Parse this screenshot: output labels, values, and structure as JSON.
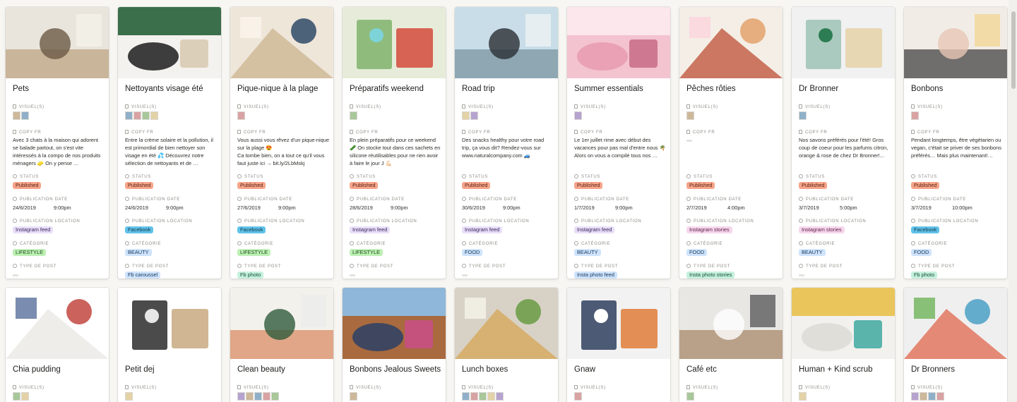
{
  "labels": {
    "visuels": "VISUEL(S)",
    "copy": "COPY FR",
    "status": "STATUS",
    "date": "PUBLICATION DATE",
    "location": "PUBLICATION LOCATION",
    "categorie": "CATÉGORIE",
    "type": "TYPE DE POST"
  },
  "row1": [
    {
      "title": "Pets",
      "copy": "Avec 3 chats à la maison qui adorent se balade partout, on s'est vite intéressés à la compo de nos produits ménagers 🧽 On y pense …",
      "status": "Published",
      "date": "24/6/2019",
      "time": "9:00pm",
      "location": "Instagram feed",
      "categorie": "LIFESTYLE",
      "type": ""
    },
    {
      "title": "Nettoyants visage été",
      "copy": "Entre la crème solaire et la pollution, il est primordial de bien nettoyer son visage en été 💦 Découvrez notre sélection de nettoyants et de …",
      "status": "Published",
      "date": "24/6/2019",
      "time": "9:00pm",
      "location": "Facebook",
      "categorie": "BEAUTY",
      "type": "Fb caroussel"
    },
    {
      "title": "Pique-nique à la plage",
      "copy": "Vous aussi vous rêvez d'un pique-nique sur la plage 😍\nCa tombe bien, on a tout ce qu'il vous faut juste ici → bit.ly/2LbMskj",
      "status": "Published",
      "date": "27/6/2019",
      "time": "9:00pm",
      "location": "Facebook",
      "categorie": "LIFESTYLE",
      "type": "Fb photo"
    },
    {
      "title": "Préparatifs weekend",
      "copy": "En plein préparatifs pour ce weekend 🥒 On stocke tout dans ces sachets en silicone réutilisables pour ne rien avoir à faire le jour J 💪🏻",
      "status": "Published",
      "date": "28/6/2019",
      "time": "9:00pm",
      "location": "Instagram feed",
      "categorie": "LIFESTYLE",
      "type": ""
    },
    {
      "title": "Road trip",
      "copy": "Des snacks healthy pour votre road trip, ça vous dit?  Rendez-vous sur www.naturalcompany.com 🚙",
      "status": "Published",
      "date": "30/6/2019",
      "time": "9:00pm",
      "location": "Instagram feed",
      "categorie": "FOOD",
      "type": ""
    },
    {
      "title": "Summer essentials",
      "copy": "Le 1er juillet rime avec début des vacances pour pas mal d'entre nous 🌴\nAlors on vous a compilé tous nos …",
      "status": "Published",
      "date": "1/7/2019",
      "time": "9:00pm",
      "location": "Instagram feed",
      "categorie": "BEAUTY",
      "type": "Insta photo feed"
    },
    {
      "title": "Pêches rôties",
      "copy": "",
      "status": "Published",
      "date": "2/7/2019",
      "time": "4:00pm",
      "location": "Instagram stories",
      "categorie": "FOOD",
      "type": "Insta photo stories"
    },
    {
      "title": "Dr Bronner",
      "copy": "Nos savons préférés pour l'été! Gros coup de coeur pour les parfums citron, orange & rose de chez Dr Bronner!...",
      "status": "Published",
      "date": "3/7/2019",
      "time": "5:00pm",
      "location": "Instagram stories",
      "categorie": "BEAUTY",
      "type": ""
    },
    {
      "title": "Bonbons",
      "copy": "Pendant longtemps, être végétarien ou vegan, c'était se priver de ses bonbons préférés… Mais plus maintenant!…",
      "status": "Published",
      "date": "3/7/2019",
      "time": "10:00pm",
      "location": "Facebook",
      "categorie": "FOOD",
      "type": "Fb photo"
    }
  ],
  "row2": [
    {
      "title": "Chia pudding"
    },
    {
      "title": "Petit dej"
    },
    {
      "title": "Clean beauty"
    },
    {
      "title": "Bonbons Jealous Sweets"
    },
    {
      "title": "Lunch boxes"
    },
    {
      "title": "Gnaw"
    },
    {
      "title": "Café etc"
    },
    {
      "title": "Human + Kind scrub"
    },
    {
      "title": "Dr Bronners"
    }
  ],
  "colors": {
    "published": "#f6a58a",
    "instagram_feed": "#e8def7",
    "facebook": "#62c3ea",
    "instagram_stories": "#f6d7ec",
    "lifestyle": "#bdf0b4",
    "beauty_food": "#cfe3fb",
    "background": "#f7f6f3"
  }
}
